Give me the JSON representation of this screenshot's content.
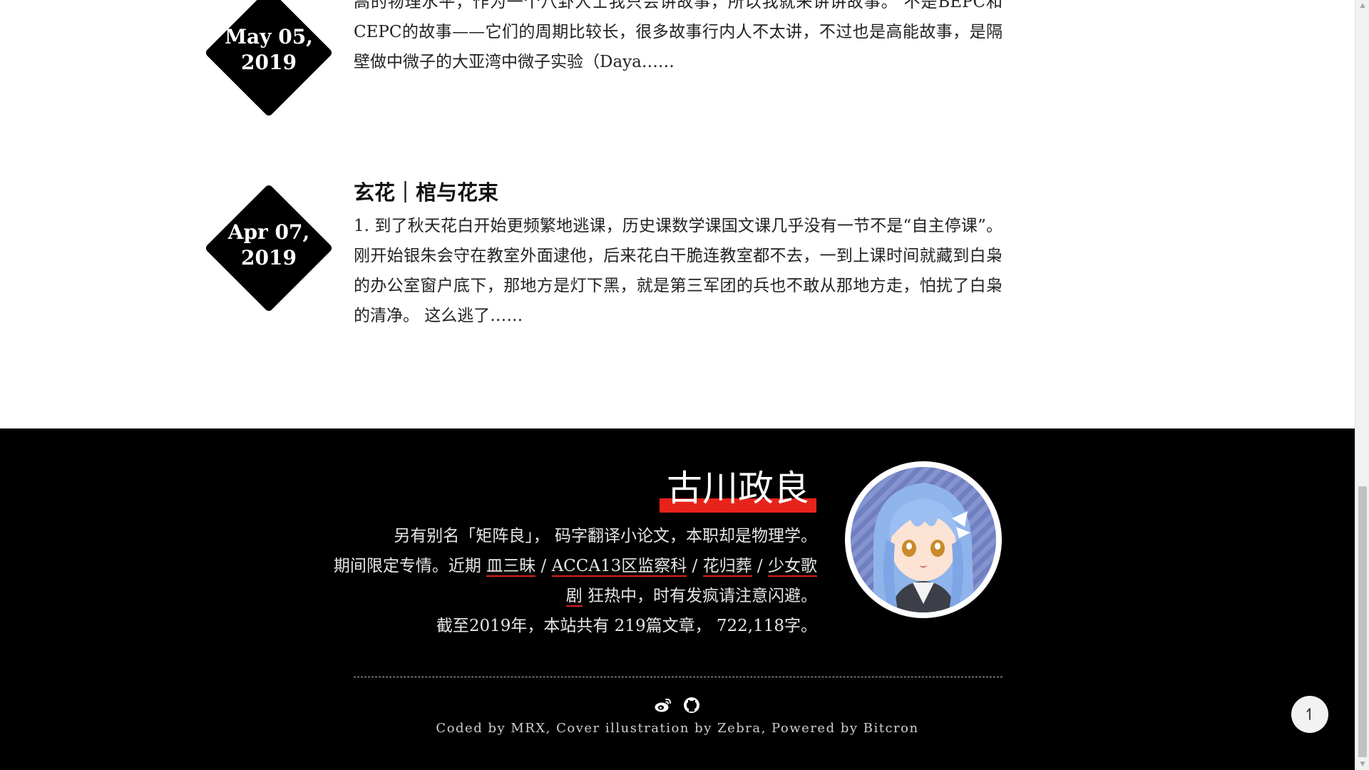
{
  "posts": [
    {
      "date_line1": "May 05,",
      "date_line2": "2019",
      "title": "",
      "excerpt": "科研故事也可以很惊心动魄跌宕起伏的。阿佐@葛桜 说了很多物理和科普，我没阿佐那么高的物理水平，作为一个八卦人士我只会讲故事，所以我就来讲讲故事。 不是BEPC和CEPC的故事——它们的周期比较长，很多故事行内人不太讲，不过也是高能故事，是隔壁做中微子的大亚湾中微子实验（Daya……"
    },
    {
      "date_line1": "Apr 07,",
      "date_line2": "2019",
      "title": "玄花｜棺与花束",
      "excerpt": "1. 到了秋天花白开始更频繁地逃课，历史课数学课国文课几乎没有一节不是“自主停课”。刚开始银朱会守在教室外面逮他，后来花白干脆连教室都不去，一到上课时间就藏到白枭的办公室窗户底下，那地方是灯下黑，就是第三军团的兵也不敢从那地方走，怕扰了白枭的清净。 这么逃了……"
    }
  ],
  "footer": {
    "author_name": "古川政良",
    "bio_line1": "另有别名「矩阵良」， 码字翻译小论文，本职却是物理学。",
    "bio_line2_prefix": "期间限定专情。近期 ",
    "links": [
      "皿三昧",
      "ACCA13区监察科",
      "花归葬",
      "少女歌剧"
    ],
    "sep": " / ",
    "bio_line2_suffix": " 狂热中，时有发疯请注意闪避。",
    "bio_line3": "截至2019年，本站共有 219篇文章， 722,118字。",
    "credits": "Coded by MRX, Cover illustration by Zebra, Powered by Bitcron",
    "social_icons": [
      "weibo-icon",
      "github-icon"
    ]
  },
  "back_to_top_icon": "arrow-up-icon",
  "colors": {
    "accent_red": "#e8231a",
    "footer_bg": "#000000",
    "avatar_hair": "#8fb4ec"
  }
}
